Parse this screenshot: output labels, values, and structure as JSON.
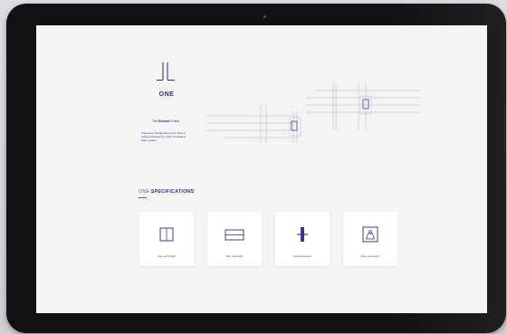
{
  "brand": {
    "word": "ONE",
    "tagline_bold": "Minimal",
    "tagline": "The Minimal Frame"
  },
  "hero": {
    "description": "Frameless transparency from floor to ceiling achieved by a fully concealed track system."
  },
  "specs": {
    "title_light": "ONE",
    "title_bold": "SPECIFICATIONS",
    "cards": [
      {
        "label": "Max. leaf height",
        "icon": "leaf-height-icon"
      },
      {
        "label": "Max. leaf width",
        "icon": "leaf-width-icon"
      },
      {
        "label": "Glass thickness",
        "icon": "glass-thickness-icon"
      },
      {
        "label": "Max. leaf weight",
        "icon": "leaf-weight-icon"
      }
    ]
  },
  "colors": {
    "accent": "#2e2a7a",
    "screen_bg": "#f4f4f4",
    "bezel": "#121214"
  }
}
